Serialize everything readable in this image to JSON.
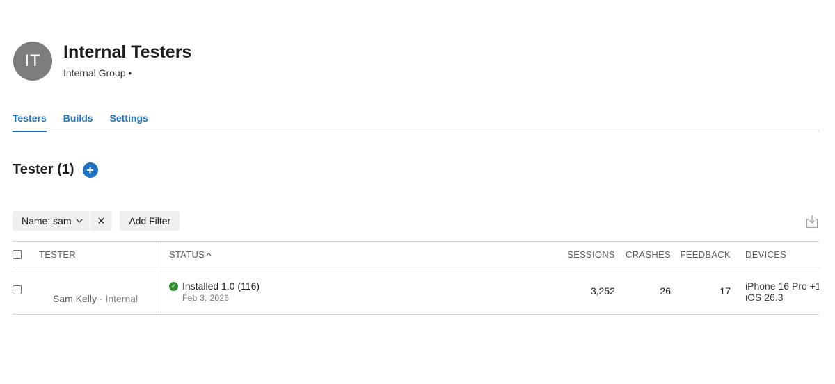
{
  "header": {
    "avatar_initials": "IT",
    "title": "Internal Testers",
    "subtitle": "Internal Group •"
  },
  "tabs": [
    {
      "label": "Testers",
      "active": true
    },
    {
      "label": "Builds",
      "active": false
    },
    {
      "label": "Settings",
      "active": false
    }
  ],
  "section": {
    "title": "Tester (1)",
    "add_icon": "plus-circle-icon"
  },
  "filters": {
    "name_filter_label": "Name: sam",
    "clear_glyph": "✕",
    "add_filter_label": "Add Filter"
  },
  "table": {
    "columns": {
      "tester": "TESTER",
      "status": "STATUS",
      "sessions": "SESSIONS",
      "crashes": "CRASHES",
      "feedback": "FEEDBACK",
      "devices": "DEVICES"
    },
    "rows": [
      {
        "tester_name": "Sam Kelly",
        "tester_type": "· Internal",
        "status": "Installed 1.0 (116)",
        "status_date": "Feb 3, 2026",
        "sessions": "3,252",
        "crashes": "26",
        "feedback": "17",
        "device": "iPhone 16 Pro +1",
        "os": "iOS 26.3"
      }
    ]
  },
  "colors": {
    "accent": "#1f6fc2",
    "status_ok": "#2e8b2e",
    "avatar_bg": "#7d7d7d"
  }
}
